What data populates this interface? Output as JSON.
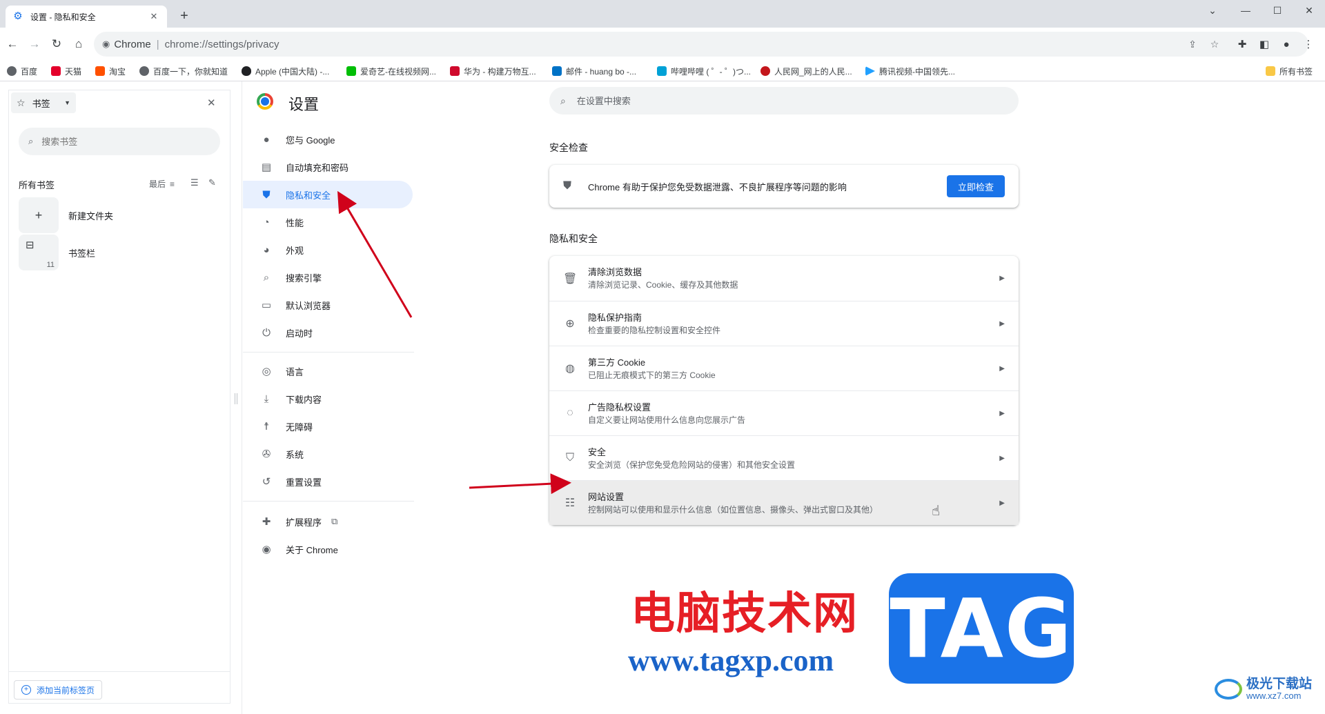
{
  "browser": {
    "tab": {
      "title": "设置 - 隐私和安全"
    },
    "address": {
      "origin": "Chrome",
      "url": "chrome://settings/privacy"
    },
    "bookmarks": [
      {
        "label": "百度",
        "color": "#5f6368"
      },
      {
        "label": "天猫",
        "color": "#e4002b"
      },
      {
        "label": "淘宝",
        "color": "#ff5000"
      },
      {
        "label": "百度一下，你就知道",
        "color": "#5f6368"
      },
      {
        "label": "Apple (中国大陆) -...",
        "color": "#202124"
      },
      {
        "label": "爱奇艺-在线视频网...",
        "color": "#00be06"
      },
      {
        "label": "华为 - 构建万物互...",
        "color": "#cf0a2c"
      },
      {
        "label": "邮件 - huang bo -...",
        "color": "#0072c6"
      },
      {
        "label": "哔哩哔哩 ( ゜- ゜)つ...",
        "color": "#00a1d6"
      },
      {
        "label": "人民网_网上的人民...",
        "color": "#c4161c"
      },
      {
        "label": "腾讯视频-中国领先...",
        "color": "#20a0ff"
      }
    ],
    "all_bookmarks_label": "所有书签"
  },
  "side_panel": {
    "header": "书签",
    "search_placeholder": "搜索书签",
    "section_label": "所有书签",
    "sort_label": "最后",
    "items": [
      {
        "label": "新建文件夹"
      },
      {
        "label": "书签栏",
        "count": "11"
      }
    ],
    "add_button": "添加当前标签页"
  },
  "settings": {
    "title": "设置",
    "search_placeholder": "在设置中搜索",
    "nav": [
      {
        "label": "您与 Google"
      },
      {
        "label": "自动填充和密码"
      },
      {
        "label": "隐私和安全"
      },
      {
        "label": "性能"
      },
      {
        "label": "外观"
      },
      {
        "label": "搜索引擎"
      },
      {
        "label": "默认浏览器"
      },
      {
        "label": "启动时"
      },
      {
        "label": "语言"
      },
      {
        "label": "下载内容"
      },
      {
        "label": "无障碍"
      },
      {
        "label": "系统"
      },
      {
        "label": "重置设置"
      },
      {
        "label": "扩展程序"
      },
      {
        "label": "关于 Chrome"
      }
    ],
    "safety_check": {
      "heading": "安全检查",
      "text": "Chrome 有助于保护您免受数据泄露、不良扩展程序等问题的影响",
      "button": "立即检查"
    },
    "privacy": {
      "heading": "隐私和安全",
      "rows": [
        {
          "title": "清除浏览数据",
          "desc": "清除浏览记录、Cookie、缓存及其他数据"
        },
        {
          "title": "隐私保护指南",
          "desc": "检查重要的隐私控制设置和安全控件"
        },
        {
          "title": "第三方 Cookie",
          "desc": "已阻止无痕模式下的第三方 Cookie"
        },
        {
          "title": "广告隐私权设置",
          "desc": "自定义要让网站使用什么信息向您展示广告"
        },
        {
          "title": "安全",
          "desc": "安全浏览（保护您免受危险网站的侵害）和其他安全设置"
        },
        {
          "title": "网站设置",
          "desc": "控制网站可以使用和显示什么信息（如位置信息、摄像头、弹出式窗口及其他）"
        }
      ]
    }
  },
  "watermark": {
    "site_cn": "电脑技术网",
    "site_url": "www.tagxp.com",
    "tag": "TAG",
    "xz_name": "极光下载站",
    "xz_url": "www.xz7.com"
  },
  "colors": {
    "accent": "#1a73e8",
    "annotation_arrow": "#d0021b",
    "watermark_red": "#e61f25"
  }
}
